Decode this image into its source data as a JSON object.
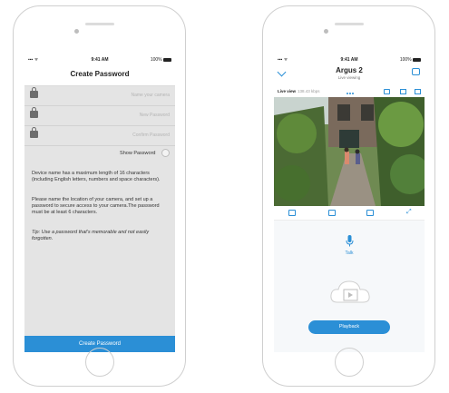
{
  "left_screen": {
    "status": {
      "time": "9:41 AM",
      "battery": "100%"
    },
    "title": "Create Password",
    "fields": [
      {
        "placeholder": "Name your camera"
      },
      {
        "placeholder": "New Password"
      },
      {
        "placeholder": "Confirm Password"
      }
    ],
    "show_password_label": "Show Password",
    "info_paragraphs": [
      "Device name has a maximum length of 16 characters (including English letters, numbers and space characters).",
      "Please name the location of your camera, and set up a password to secure access to your camera.The password must be at least 6 characters.",
      "Tip: Use a password that's memorable and not easily forgotten."
    ],
    "create_button_label": "Create Password"
  },
  "right_screen": {
    "status": {
      "time": "9:41 AM",
      "battery": "100%"
    },
    "title": "Argus 2",
    "subtitle": "Live viewing",
    "live_label": "Live view",
    "live_rate": "138.43 kbps",
    "talk_label": "Talk",
    "playback_label": "Playback"
  },
  "colors": {
    "accent": "#2b8fd6",
    "screen_bg": "#e4e4e4"
  }
}
